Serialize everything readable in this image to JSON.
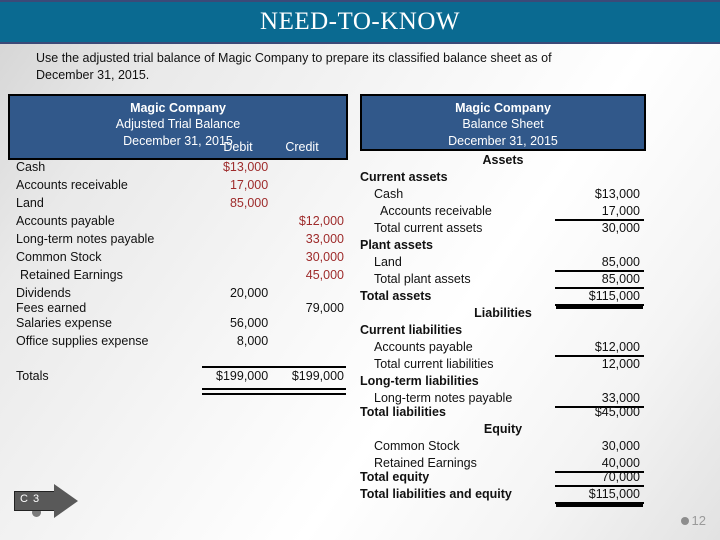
{
  "header": {
    "title": "NEED-TO-KNOW"
  },
  "intro": {
    "text": "Use the adjusted trial balance of Magic Company to prepare its classified balance sheet as of December 31, 2015."
  },
  "trial_balance": {
    "company": "Magic Company",
    "statement": "Adjusted Trial Balance",
    "date": "December 31, 2015",
    "col_debit": "Debit",
    "col_credit": "Credit",
    "rows": [
      {
        "label": "Cash",
        "debit": "$13,000",
        "credit": ""
      },
      {
        "label": "Accounts receivable",
        "debit": "17,000",
        "credit": ""
      },
      {
        "label": "Land",
        "debit": "85,000",
        "credit": ""
      },
      {
        "label": "Accounts payable",
        "debit": "",
        "credit": "$12,000"
      },
      {
        "label": "Long-term notes payable",
        "debit": "",
        "credit": "33,000"
      },
      {
        "label": "Common Stock",
        "debit": "",
        "credit": "30,000"
      },
      {
        "label": "Retained Earnings",
        "debit": "",
        "credit": "45,000"
      },
      {
        "label": "Dividends",
        "debit": "20,000",
        "credit": ""
      },
      {
        "label": "Fees earned",
        "debit": "",
        "credit": "79,000"
      },
      {
        "label": "Salaries expense",
        "debit": "56,000",
        "credit": ""
      },
      {
        "label": "Office supplies expense",
        "debit": "8,000",
        "credit": ""
      }
    ],
    "totals": {
      "label": "Totals",
      "debit": "$199,000",
      "credit": "$199,000"
    }
  },
  "balance_sheet": {
    "company": "Magic Company",
    "statement": "Balance Sheet",
    "date": "December 31, 2015",
    "section_assets": "Assets",
    "section_liabilities": "Liabilities",
    "section_equity": "Equity",
    "current_assets_title": "Current assets",
    "cash_label": "Cash",
    "cash_amount": "$13,000",
    "ar_label": "Accounts receivable",
    "ar_amount": "17,000",
    "total_current_assets_label": "Total current assets",
    "total_current_assets_amount": "30,000",
    "plant_assets_title": "Plant assets",
    "land_label": "Land",
    "land_amount": "85,000",
    "total_plant_assets_label": "Total plant assets",
    "total_plant_assets_amount": "85,000",
    "total_assets_label": "Total assets",
    "total_assets_amount": "$115,000",
    "current_liabilities_title": "Current liabilities",
    "ap_label": "Accounts payable",
    "ap_amount": "$12,000",
    "total_current_liabilities_label": "Total current liabilities",
    "total_current_liabilities_amount": "12,000",
    "longterm_liabilities_title": "Long-term liabilities",
    "ltnp_label": "Long-term notes payable",
    "ltnp_amount": "33,000",
    "total_liabilities_label": "Total liabilities",
    "total_liabilities_amount": "$45,000",
    "common_stock_label": "Common Stock",
    "common_stock_amount": "30,000",
    "retained_earnings_label": "Retained Earnings",
    "retained_earnings_amount": "40,000",
    "total_equity_label": "Total equity",
    "total_equity_amount": "70,000",
    "total_liab_equity_label": "Total liabilities and equity",
    "total_liab_equity_amount": "$115,000"
  },
  "chapter_badge": {
    "label": "C 3"
  },
  "slide": {
    "number": "12"
  },
  "colors": {
    "banner": "#0a6a91",
    "stmt_header": "#31588a",
    "amount_red": "#9e2b2b",
    "text": "#111111"
  }
}
